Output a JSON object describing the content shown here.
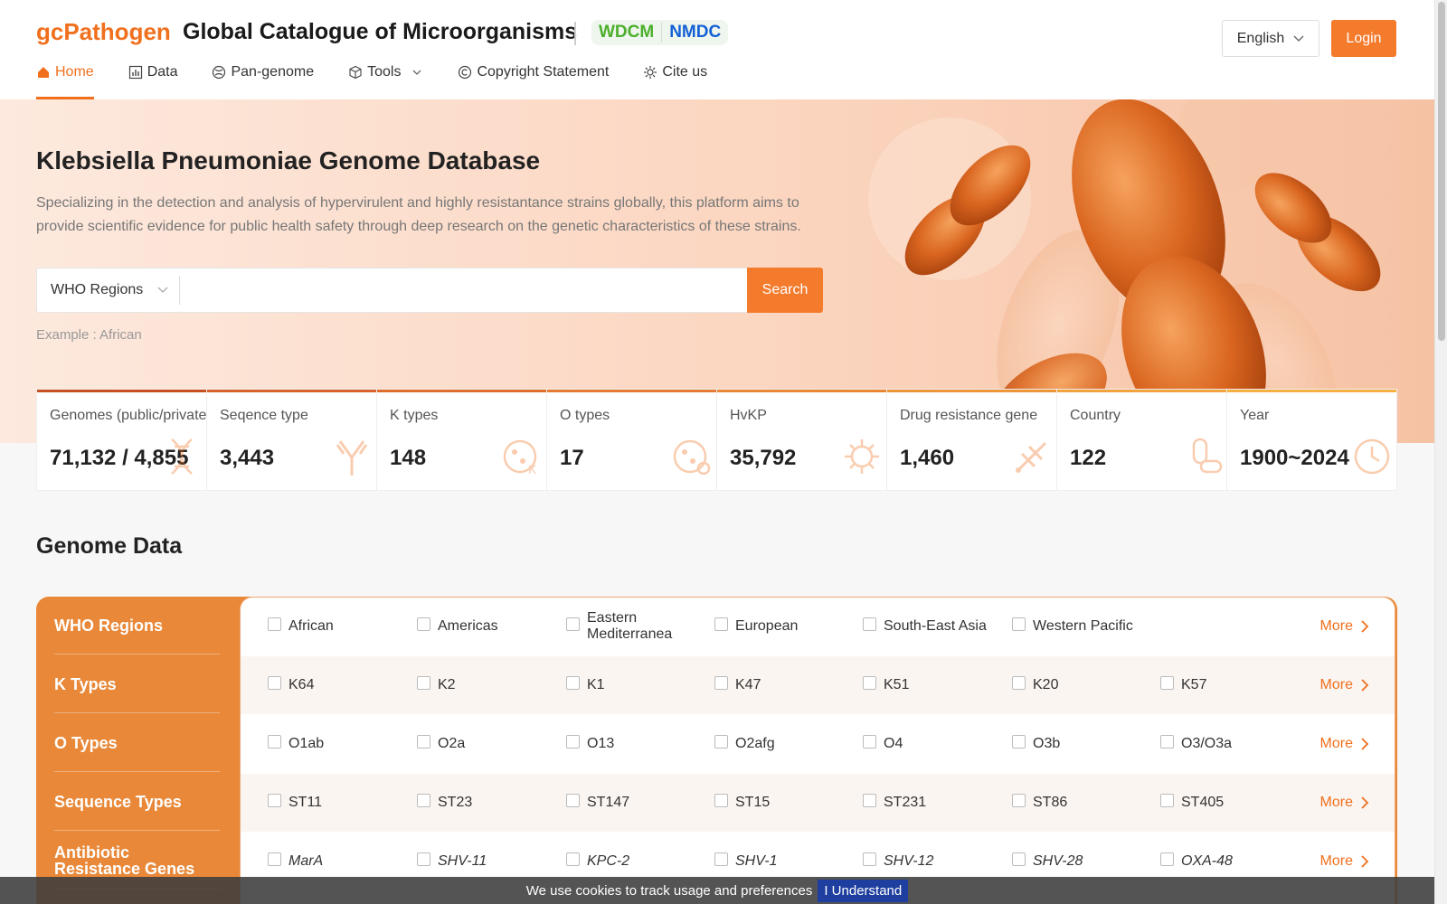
{
  "header": {
    "logo": "gcPathogen",
    "title": "Global Catalogue of Microorganisms",
    "partners": [
      "WDCM",
      "NMDC"
    ],
    "language": "English",
    "login_label": "Login"
  },
  "nav": [
    {
      "label": "Home",
      "icon": "home-icon",
      "active": true
    },
    {
      "label": "Data",
      "icon": "bar-chart-icon"
    },
    {
      "label": "Pan-genome",
      "icon": "pan-genome-icon"
    },
    {
      "label": "Tools",
      "icon": "cube-icon",
      "dropdown": true
    },
    {
      "label": "Copyright Statement",
      "icon": "copyright-icon"
    },
    {
      "label": "Cite us",
      "icon": "gear-icon"
    }
  ],
  "hero": {
    "title": "Klebsiella Pneumoniae Genome Database",
    "description": "Specializing in the detection and analysis of hypervirulent and highly resistantance strains globally, this platform aims to provide scientific evidence for public health safety through deep research on the genetic characteristics of these strains.",
    "search_scope": "WHO Regions",
    "search_value": "",
    "search_button": "Search",
    "example": "Example : African"
  },
  "stats": [
    {
      "label": "Genomes (public/private)",
      "value": "71,132 / 4,855",
      "bar_color": "#c94f1e",
      "icon": "dna-icon"
    },
    {
      "label": "Seqence type",
      "value": "3,443",
      "bar_color": "#d8622a",
      "icon": "antibody-icon"
    },
    {
      "label": "K types",
      "value": "148",
      "bar_color": "#e06d2c",
      "icon": "cell-k-icon"
    },
    {
      "label": "O types",
      "value": "17",
      "bar_color": "#e57a30",
      "icon": "cell-o-icon"
    },
    {
      "label": "HvKP",
      "value": "35,792",
      "bar_color": "#ea8634",
      "icon": "virus-icon"
    },
    {
      "label": "Drug resistance gene",
      "value": "1,460",
      "bar_color": "#ee9538",
      "icon": "gene-icon"
    },
    {
      "label": "Country",
      "value": "122",
      "bar_color": "#f3a33d",
      "icon": "pill-icon"
    },
    {
      "label": "Year",
      "value": "1900~2024",
      "bar_color": "#f6b042",
      "icon": "clock-icon"
    }
  ],
  "genome_data": {
    "title": "Genome Data",
    "more_label": "More",
    "categories": [
      {
        "name": "WHO Regions",
        "italic": false,
        "options": [
          "African",
          "Americas",
          "Eastern Mediterranea",
          "European",
          "South-East Asia",
          "Western Pacific"
        ]
      },
      {
        "name": "K Types",
        "italic": false,
        "options": [
          "K64",
          "K2",
          "K1",
          "K47",
          "K51",
          " K20",
          "K57"
        ]
      },
      {
        "name": "O Types",
        "italic": false,
        "options": [
          "O1ab",
          "O2a",
          "O13",
          "O2afg",
          "O4",
          "O3b",
          "O3/O3a"
        ]
      },
      {
        "name": "Sequence Types",
        "italic": false,
        "options": [
          "ST11",
          "ST23",
          "ST147",
          "ST15",
          "ST231",
          "ST86",
          "ST405"
        ]
      },
      {
        "name": "Antibiotic Resistance Genes",
        "italic": true,
        "options": [
          "MarA",
          "SHV-11",
          "KPC-2",
          "SHV-1",
          "SHV-12",
          "SHV-28",
          "OXA-48"
        ]
      }
    ]
  },
  "cookie": {
    "text": "We use cookies to track usage and preferences",
    "button": "I Understand"
  }
}
